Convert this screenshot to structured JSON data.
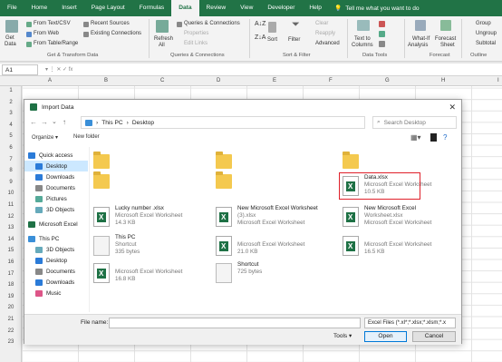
{
  "ribbon": {
    "tabs": [
      "File",
      "Home",
      "Insert",
      "Page Layout",
      "Formulas",
      "Data",
      "Review",
      "View",
      "Developer",
      "Help"
    ],
    "tell_me": "Tell me what you want to do",
    "get_data": [
      "Get",
      "Data"
    ],
    "from_text": "From Text/CSV",
    "from_web": "From Web",
    "from_table": "From Table/Range",
    "recent_sources": "Recent Sources",
    "existing_conn": "Existing Connections",
    "refresh": [
      "Refresh",
      "All"
    ],
    "queries_conn": "Queries & Connections",
    "properties": "Properties",
    "edit_links": "Edit Links",
    "sort": "Sort",
    "filter": "Filter",
    "clear": "Clear",
    "reapply": "Reapply",
    "advanced": "Advanced",
    "text_to_columns": [
      "Text to",
      "Columns"
    ],
    "whatif": [
      "What-If",
      "Analysis"
    ],
    "forecast": [
      "Forecast",
      "Sheet"
    ],
    "group": "Group",
    "ungroup": "Ungroup",
    "subtotal": "Subtotal",
    "groups": [
      "Get & Transform Data",
      "Queries & Connections",
      "Sort & Filter",
      "Data Tools",
      "Forecast",
      "Outline"
    ]
  },
  "namebox": "A1",
  "columns": [
    "A",
    "B",
    "C",
    "D",
    "E",
    "F",
    "G",
    "H",
    "I"
  ],
  "rows": [
    "1",
    "2",
    "3",
    "4",
    "5",
    "6",
    "7",
    "8",
    "9",
    "10",
    "11",
    "12",
    "13",
    "14",
    "15",
    "16",
    "17",
    "18",
    "19",
    "20",
    "21",
    "22",
    "23"
  ],
  "dialog": {
    "title": "Import Data",
    "breadcrumb": [
      "This PC",
      "Desktop"
    ],
    "search_placeholder": "Search Desktop",
    "organize": "Organize ▾",
    "new_folder": "New folder",
    "sidebar": [
      {
        "label": "Quick access",
        "icon": "star-icon"
      },
      {
        "label": "Desktop",
        "icon": "desktop-icon",
        "selected": true
      },
      {
        "label": "Downloads",
        "icon": "download-icon"
      },
      {
        "label": "Documents",
        "icon": "documents-icon"
      },
      {
        "label": "Pictures",
        "icon": "pictures-icon"
      },
      {
        "label": "3D Objects",
        "icon": "3d-objects-icon"
      },
      {
        "label": "Microsoft Excel",
        "icon": "excel-icon"
      },
      {
        "label": "This PC",
        "icon": "pc-icon"
      },
      {
        "label": "3D Objects",
        "icon": "3d-objects-icon"
      },
      {
        "label": "Desktop",
        "icon": "desktop-icon"
      },
      {
        "label": "Documents",
        "icon": "documents-icon"
      },
      {
        "label": "Downloads",
        "icon": "download-icon"
      },
      {
        "label": "Music",
        "icon": "music-icon"
      }
    ],
    "files": [
      {
        "kind": "folder",
        "l1": "",
        "l2": "",
        "l3": ""
      },
      {
        "kind": "folder",
        "l1": "",
        "l2": "",
        "l3": ""
      },
      {
        "kind": "folder",
        "l1": "",
        "l2": "",
        "l3": ""
      },
      {
        "kind": "folder",
        "l1": "",
        "l2": "",
        "l3": ""
      },
      {
        "kind": "folder",
        "l1": "",
        "l2": "",
        "l3": ""
      },
      {
        "kind": "excel",
        "l1": "Data.xlsx",
        "l2": "Microsoft Excel Worksheet",
        "l3": "10.5 KB",
        "highlight": true
      },
      {
        "kind": "excel",
        "l1": "Lucky number .xlsx",
        "l2": "Microsoft Excel Worksheet",
        "l3": "14.3 KB"
      },
      {
        "kind": "excel",
        "l1": "New Microsoft Excel Worksheet",
        "l2": "(3).xlsx",
        "l3": "Microsoft Excel Worksheet"
      },
      {
        "kind": "excel",
        "l1": "New Microsoft Excel",
        "l2": "Worksheet.xlsx",
        "l3": "Microsoft Excel Worksheet"
      },
      {
        "kind": "shortcut",
        "l1": "This PC",
        "l2": "Shortcut",
        "l3": "335 bytes"
      },
      {
        "kind": "excel",
        "l1": "",
        "l2": "Microsoft Excel Worksheet",
        "l3": "21.0 KB"
      },
      {
        "kind": "excel",
        "l1": "",
        "l2": "Microsoft Excel Worksheet",
        "l3": "16.5 KB"
      },
      {
        "kind": "excel",
        "l1": "",
        "l2": "Microsoft Excel Worksheet",
        "l3": "16.8 KB"
      },
      {
        "kind": "shortcut",
        "l1": "Shortcut",
        "l2": "725 bytes",
        "l3": ""
      }
    ],
    "filename_label": "File name:",
    "filetype": "Excel Files (*.xl*;*.xlsx;*.xlsm;*.x",
    "tools": "Tools ▾",
    "open": "Open",
    "cancel": "Cancel"
  }
}
